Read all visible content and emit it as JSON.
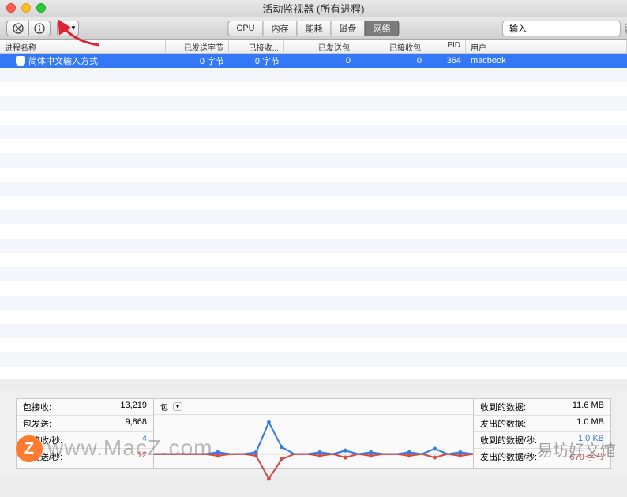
{
  "window": {
    "title": "活动监视器 (所有进程)"
  },
  "tabs": {
    "cpu": "CPU",
    "memory": "内存",
    "energy": "能耗",
    "disk": "磁盘",
    "network": "网络"
  },
  "search": {
    "placeholder": "",
    "value": "输入"
  },
  "columns": {
    "name": "进程名称",
    "sent_bytes": "已发送字节",
    "recv_bytes": "已接收...",
    "sent_packets": "已发送包",
    "recv_packets": "已接收包",
    "pid": "PID",
    "user": "用户"
  },
  "rows": [
    {
      "name": "简体中文输入方式",
      "sent_bytes": "0 字节",
      "recv_bytes": "0 字节",
      "sent_packets": "0",
      "recv_packets": "0",
      "pid": "364",
      "user": "macbook",
      "selected": true
    }
  ],
  "footer": {
    "left": {
      "packets_in_label": "包接收:",
      "packets_in": "13,219",
      "packets_out_label": "包发送:",
      "packets_out": "9,868",
      "packets_in_sec_label": "包接收/秒:",
      "packets_in_sec": "4",
      "packets_out_sec_label": "包发送/秒:",
      "packets_out_sec": "12"
    },
    "chart": {
      "label": "包",
      "dropdown_icon": "▾"
    },
    "right": {
      "data_in_label": "收到的数据:",
      "data_in": "11.6 MB",
      "data_out_label": "发出的数据:",
      "data_out": "1.0 MB",
      "data_in_sec_label": "收到的数据/秒:",
      "data_in_sec": "1.0 KB",
      "data_out_sec_label": "发出的数据/秒:",
      "data_out_sec": "679 字节"
    }
  },
  "chart_data": {
    "type": "line",
    "title": "包",
    "series": [
      {
        "name": "in",
        "color": "#3a7ae0",
        "values": [
          0,
          0,
          0,
          0,
          0,
          1,
          0,
          0,
          1,
          18,
          4,
          0,
          0,
          1,
          0,
          2,
          0,
          1,
          0,
          0,
          1,
          0,
          3,
          0,
          1,
          0
        ]
      },
      {
        "name": "out",
        "color": "#d24a4a",
        "values": [
          0,
          0,
          0,
          0,
          0,
          -1,
          0,
          0,
          -1,
          -14,
          -3,
          0,
          0,
          -1,
          0,
          -2,
          0,
          -1,
          0,
          0,
          -1,
          0,
          -2,
          0,
          -1,
          0
        ]
      }
    ],
    "ylim": [
      -20,
      20
    ]
  },
  "watermark": {
    "url": "www.MacZ.com",
    "logo": "Z",
    "right": "易坊好文馆"
  }
}
